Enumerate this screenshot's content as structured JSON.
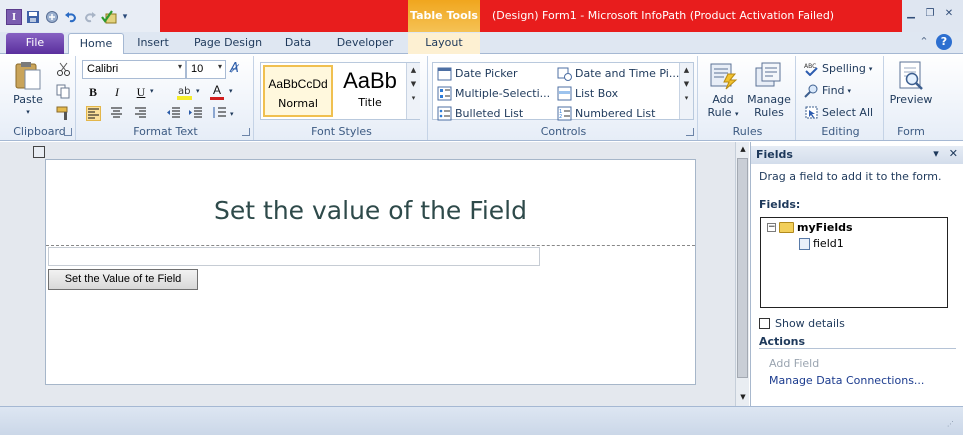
{
  "window": {
    "title": "(Design) Form1  -  Microsoft InfoPath (Product Activation Failed)",
    "contextual_tab_group": "Table Tools",
    "app_icon_letter": "I",
    "controls": [
      "minimize-icon",
      "restore-icon",
      "close-icon"
    ]
  },
  "quick_access": [
    "save-icon",
    "publish-icon",
    "undo-icon",
    "redo-icon",
    "preview-check-icon",
    "customize-qat-icon"
  ],
  "tabs": [
    {
      "label": "File"
    },
    {
      "label": "Home",
      "active": true
    },
    {
      "label": "Insert"
    },
    {
      "label": "Page Design"
    },
    {
      "label": "Data"
    },
    {
      "label": "Developer"
    },
    {
      "label": "Layout"
    }
  ],
  "ribbon": {
    "clipboard": {
      "label": "Clipboard",
      "paste": "Paste"
    },
    "format_text": {
      "label": "Format Text",
      "font": "Calibri",
      "size": "10",
      "bold": "B",
      "italic": "I",
      "underline": "U",
      "font_color": "A"
    },
    "font_styles": {
      "label": "Font Styles",
      "styles": [
        {
          "sample": "AaBbCcDd",
          "name": "Normal"
        },
        {
          "sample": "AaBb",
          "name": "Title"
        }
      ]
    },
    "controls": {
      "label": "Controls",
      "items": [
        "Date Picker",
        "Date and Time Pi...",
        "Multiple-Selecti...",
        "List Box",
        "Bulleted List",
        "Numbered List"
      ]
    },
    "rules": {
      "label": "Rules",
      "add_rule": "Add\nRule",
      "add_rule_l1": "Add",
      "add_rule_l2": "Rule",
      "manage_l1": "Manage",
      "manage_l2": "Rules"
    },
    "editing": {
      "label": "Editing",
      "spelling": "Spelling",
      "find": "Find",
      "select_all": "Select All"
    },
    "form": {
      "label": "Form",
      "preview": "Preview"
    }
  },
  "form": {
    "title": "Set the value of the Field",
    "button_label": "Set the Value of te Field"
  },
  "task_pane": {
    "title": "Fields",
    "hint": "Drag a field to add it to the form.",
    "fields_label": "Fields:",
    "tree": {
      "root": "myFields",
      "children": [
        "field1"
      ]
    },
    "show_details": "Show details",
    "actions_label": "Actions",
    "add_field": "Add Field",
    "manage_connections": "Manage Data Connections..."
  },
  "colors": {
    "accent_red": "#e81d1d",
    "file_tab": "#5a2f9d",
    "table_tools": "#f0a61e"
  }
}
